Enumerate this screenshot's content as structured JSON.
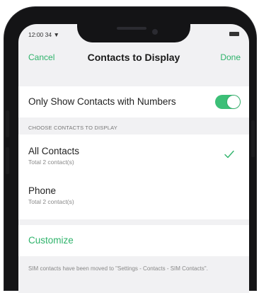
{
  "status_bar": {
    "time": "12:00 34 ▼"
  },
  "navbar": {
    "cancel_label": "Cancel",
    "title": "Contacts to Display",
    "done_label": "Done"
  },
  "toggle_row": {
    "label": "Only Show Contacts with Numbers",
    "enabled": true
  },
  "section_header": "CHOOSE CONTACTS TO DISPLAY",
  "contact_sources": [
    {
      "name": "All Contacts",
      "count_text": "Total 2 contact(s)",
      "selected": true
    },
    {
      "name": "Phone",
      "count_text": "Total 2 contact(s)",
      "selected": false
    }
  ],
  "customize_label": "Customize",
  "footer_note": "SIM contacts have been moved to \"Settings - Contacts - SIM Contacts\".",
  "colors": {
    "accent": "#2fb36b",
    "switch_on": "#3cbf77",
    "background": "#f1f1f3"
  }
}
